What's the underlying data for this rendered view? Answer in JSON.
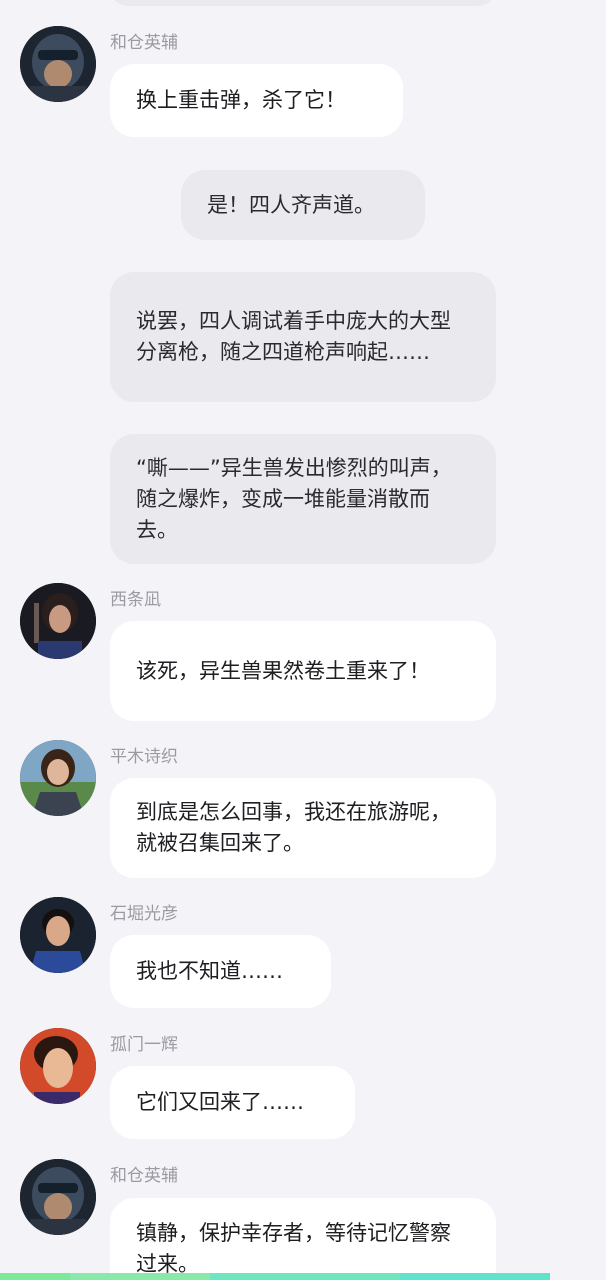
{
  "messages": [
    {
      "speaker": "和仓英辅",
      "text": "换上重击弹，杀了它！"
    },
    {
      "text": "是！四人齐声道。"
    },
    {
      "text": "说罢，四人调试着手中庞大的大型分离枪，随之四道枪声响起……"
    },
    {
      "text": "“嘶——”异生兽发出惨烈的叫声，随之爆炸，变成一堆能量消散而去。"
    },
    {
      "speaker": "西条凪",
      "text": "该死，异生兽果然卷土重来了！"
    },
    {
      "speaker": "平木诗织",
      "text": "到底是怎么回事，我还在旅游呢，就被召集回来了。"
    },
    {
      "speaker": "石堀光彦",
      "text": "我也不知道……"
    },
    {
      "speaker": "孤门一辉",
      "text": "它们又回来了……"
    },
    {
      "speaker": "和仓英辅",
      "text": "镇静，保护幸存者，等待记忆警察过来。"
    }
  ],
  "colors": {
    "background": "#f4f4f8",
    "character_bubble": "#ffffff",
    "narration_bubble": "#e9e9ee",
    "speaker_name": "#9a9aa2",
    "bottom_bar": "#5fe3b0"
  }
}
